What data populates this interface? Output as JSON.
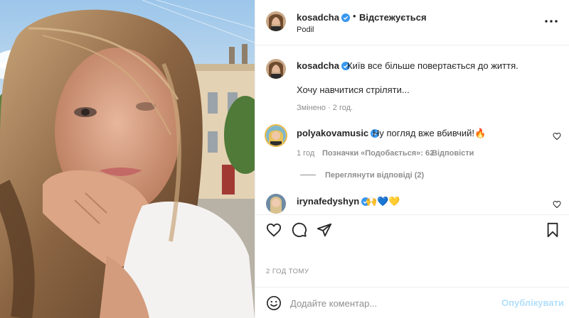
{
  "post": {
    "author": "kosadcha",
    "follow_status": "Відстежується",
    "location": "Podil",
    "caption_line1": "Київ все більше повертається до життя.",
    "caption_line2": "Хочу навчитися стріляти...",
    "caption_meta": "Змінено · 2 год.",
    "time_ago": "2 ГОД ТОМУ"
  },
  "comments": [
    {
      "user": "polyakovamusic",
      "text": "Ну погляд вже вбивчий!🔥",
      "time": "1 год",
      "likes": "Позначки «Подобається»: 62",
      "reply_label": "Відповісти",
      "view_replies": "Переглянути відповіді (2)"
    },
    {
      "user": "irynafedyshyn",
      "text": "🙌💙💛"
    }
  ],
  "add_comment": {
    "placeholder": "Додайте коментар...",
    "publish_label": "Опублікувати"
  },
  "colors": {
    "verified": "#3897f0",
    "text": "#262626",
    "muted": "#8e8e8e",
    "publish_disabled": "#b2dffc",
    "divider": "#efefef"
  },
  "icons": {
    "verified": "verified-badge-icon",
    "more": "more-options-icon",
    "like": "heart-icon",
    "comment": "comment-bubble-icon",
    "share": "paper-plane-icon",
    "save": "bookmark-icon",
    "emoji": "smiley-icon"
  }
}
